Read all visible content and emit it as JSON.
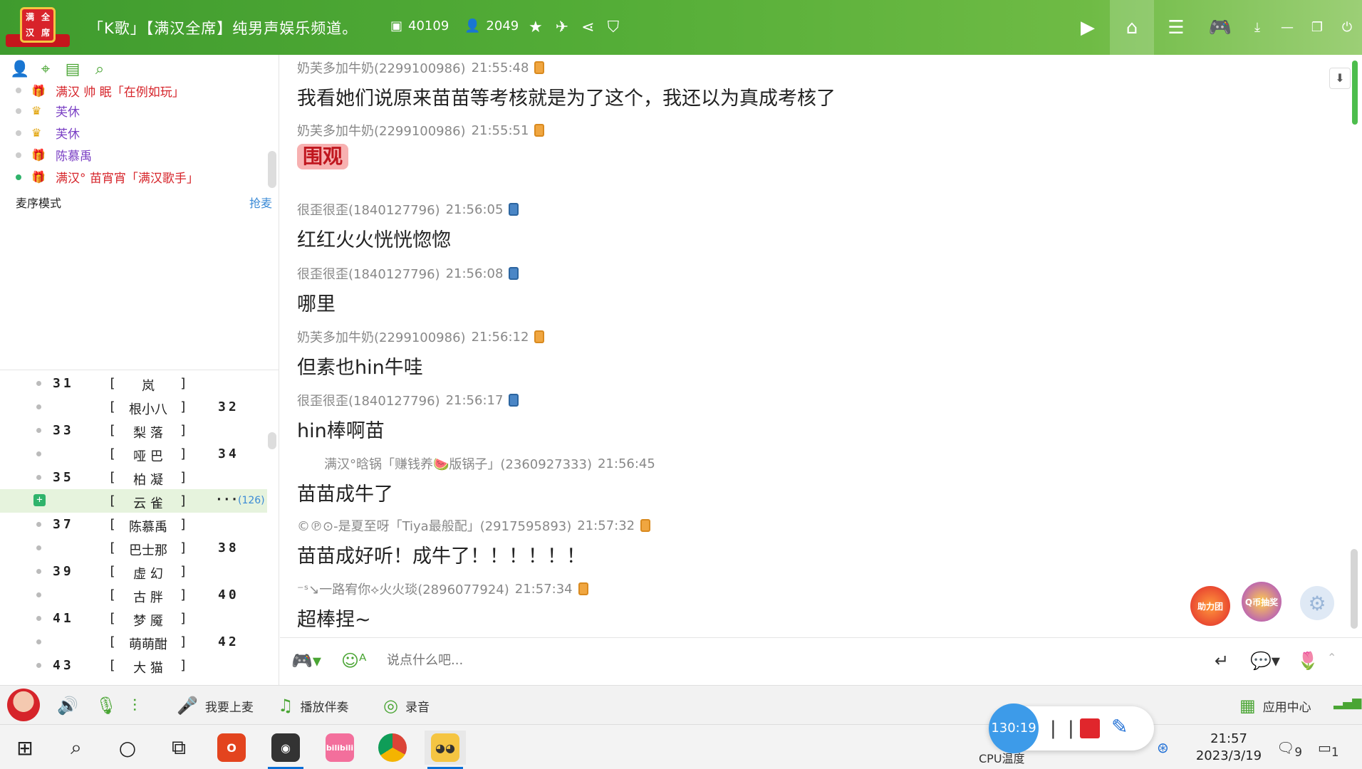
{
  "header": {
    "logo_chars": [
      "满",
      "全",
      "汉",
      "席"
    ],
    "channel_title": "「K歌」【满汉全席】纯男声娱乐频道。",
    "room_id": "40109",
    "online_count": "2049",
    "icons": [
      "star-icon",
      "plane-icon",
      "share-icon",
      "shield-icon"
    ],
    "tools": [
      "video-icon",
      "home-icon",
      "list-icon",
      "gamepad-icon",
      "download-icon"
    ],
    "window_controls": [
      "minimize-icon",
      "restore-icon",
      "close-icon"
    ]
  },
  "leftpanel": {
    "tab_icons": [
      "user-icon",
      "location-icon",
      "notes-icon",
      "search-icon"
    ],
    "members": [
      {
        "name": "满汉 帅 眠「在例如玩」",
        "status": "off",
        "color": "red"
      },
      {
        "name": "芙休",
        "status": "off",
        "color": "purple"
      },
      {
        "name": "芙休",
        "status": "off",
        "color": "purple"
      },
      {
        "name": "陈慕禹",
        "status": "off",
        "color": "purple"
      },
      {
        "name": "满汉° 苗宵宵「满汉歌手」",
        "status": "on",
        "color": "red"
      }
    ],
    "mode_label": "麦序模式",
    "grab_label": "抢麦",
    "mic_rows": [
      {
        "left_num": "31",
        "name": "岚",
        "right_num": ""
      },
      {
        "left_num": "",
        "name": "根小八",
        "right_num": "32"
      },
      {
        "left_num": "33",
        "name": "梨 落",
        "right_num": ""
      },
      {
        "left_num": "",
        "name": "哑 巴",
        "right_num": "34"
      },
      {
        "left_num": "35",
        "name": "柏 凝",
        "right_num": ""
      },
      {
        "left_num": "",
        "name": "云 雀",
        "right_num": "",
        "selected": true,
        "count": "(126)"
      },
      {
        "left_num": "37",
        "name": "陈慕禹",
        "right_num": ""
      },
      {
        "left_num": "",
        "name": "巴士那",
        "right_num": "38"
      },
      {
        "left_num": "39",
        "name": "虚 幻",
        "right_num": ""
      },
      {
        "left_num": "",
        "name": "古 胖",
        "right_num": "40"
      },
      {
        "left_num": "41",
        "name": "梦 魇",
        "right_num": ""
      },
      {
        "left_num": "",
        "name": "萌萌酣",
        "right_num": "42"
      },
      {
        "left_num": "43",
        "name": "大 猫",
        "right_num": ""
      }
    ]
  },
  "chat": {
    "messages": [
      {
        "sender": "奶芙多加牛奶(2299100986)",
        "time": "21:55:48",
        "device": "orange",
        "text": "我看她们说原来苗苗等考核就是为了这个，我还以为真成考核了"
      },
      {
        "sender": "奶芙多加牛奶(2299100986)",
        "time": "21:55:51",
        "device": "orange",
        "sticker": "围观"
      },
      {
        "sender": "很歪很歪(1840127796)",
        "time": "21:56:05",
        "device": "blue",
        "text": "红红火火恍恍惚惚"
      },
      {
        "sender": "很歪很歪(1840127796)",
        "time": "21:56:08",
        "device": "blue",
        "text": "哪里"
      },
      {
        "sender": "奶芙多加牛奶(2299100986)",
        "time": "21:56:12",
        "device": "orange",
        "text": "但素也hin牛哇"
      },
      {
        "sender": "很歪很歪(1840127796)",
        "time": "21:56:17",
        "device": "blue",
        "text": "hin棒啊苗"
      },
      {
        "sender": "满汉°晗锅「赚钱养🍉版锅子」(2360927333)",
        "time": "21:56:45",
        "device": "",
        "text": "苗苗成牛了"
      },
      {
        "sender": "©℗⊙-是夏至呀「Tiya最般配」(2917595893)",
        "time": "21:57:32",
        "device": "orange",
        "text": "苗苗成好听！成牛了！！！！！！"
      },
      {
        "sender": "⁻ˢ↘一路宥你⟡火火琰(2896077924)",
        "time": "21:57:34",
        "device": "orange",
        "text": "超棒捏~"
      }
    ],
    "float_labels": [
      "助力团",
      "Q币抽奖"
    ]
  },
  "input": {
    "placeholder": "说点什么吧..."
  },
  "toolbar": {
    "mic_up_label": "我要上麦",
    "accompany_label": "播放伴奏",
    "record_label": "录音",
    "app_center_label": "应用中心"
  },
  "taskbar": {
    "time": "21:57",
    "date": "2023/3/19",
    "cpu_label": "CPU温度",
    "notif_count": "9",
    "msg_count": "1",
    "recorder_time": "130:19",
    "app_labels": [
      "bilibili"
    ]
  },
  "colors": {
    "accent_green": "#4aa534",
    "header_green": "#54ad37",
    "record_red": "#e0262c"
  }
}
